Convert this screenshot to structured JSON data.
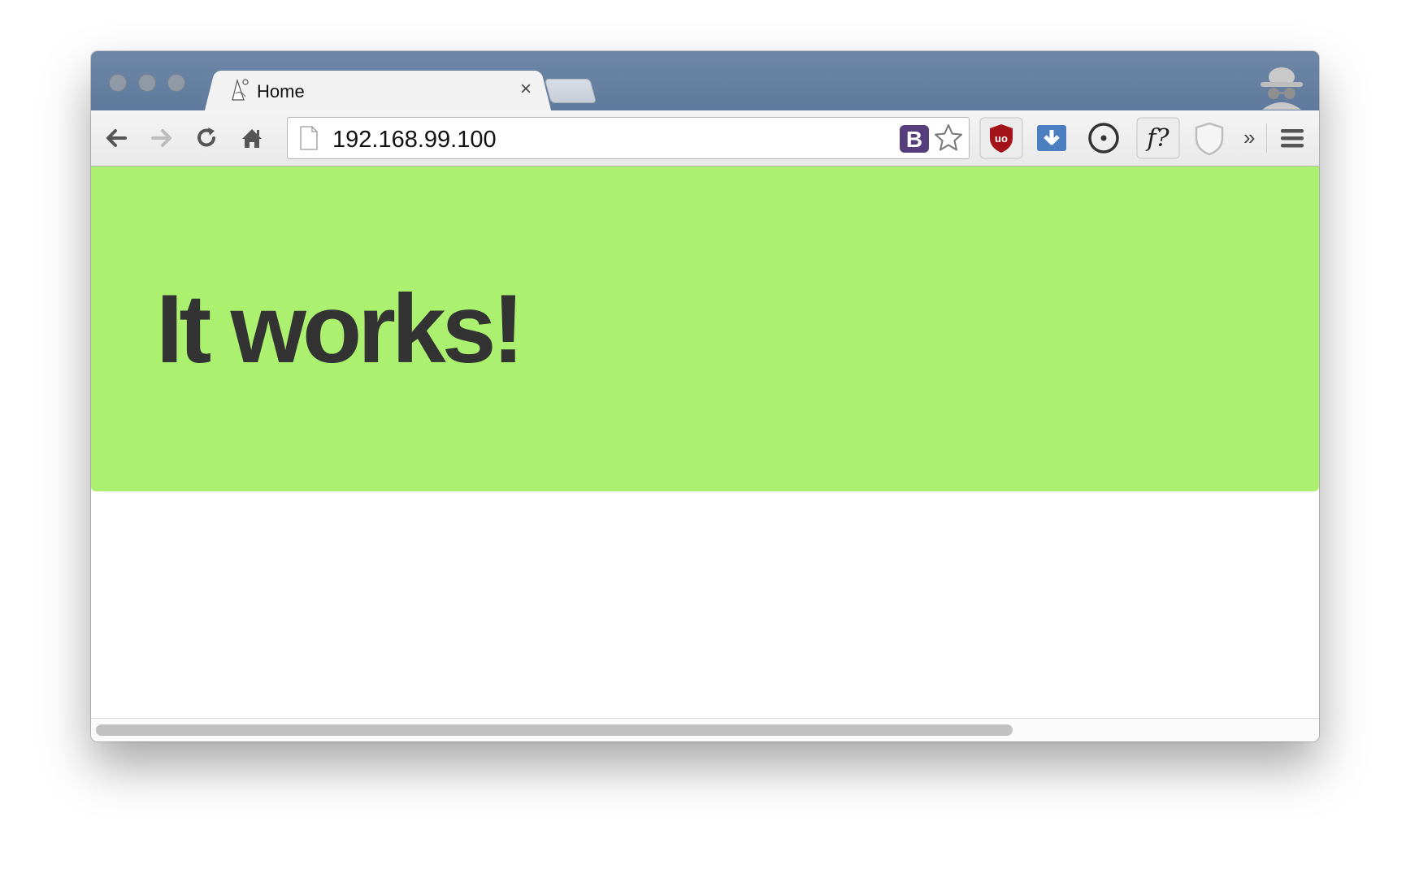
{
  "browser": {
    "tab": {
      "title": "Home",
      "close_label": "×"
    },
    "address_bar": {
      "url": "192.168.99.100"
    },
    "toolbar": {
      "back_icon": "arrow-left-icon",
      "forward_icon": "arrow-right-icon",
      "reload_icon": "reload-icon",
      "home_icon": "home-icon",
      "overflow_label": "»",
      "extensions": [
        {
          "name": "ublock-icon",
          "color": "#a4131a"
        },
        {
          "name": "download-icon",
          "color": "#4b7fc0"
        },
        {
          "name": "target-icon",
          "color": "#333333"
        },
        {
          "name": "font-finder-icon",
          "label": "f?"
        },
        {
          "name": "shield-icon",
          "color": "#cccccc"
        }
      ]
    }
  },
  "page": {
    "headline": "It works!",
    "jumbotron_color": "#abf16f"
  }
}
